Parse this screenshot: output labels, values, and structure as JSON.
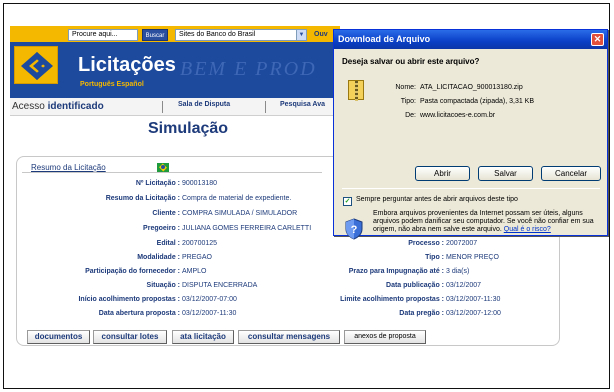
{
  "header": {
    "search_placeholder": "Procure aqui...",
    "search_button": "Buscar",
    "sites_select": "Sites do Banco do Brasil",
    "ouvidoria": "Ouv",
    "ghost_text": "BEM E PROD",
    "title": "Licitações",
    "language": "Português Español"
  },
  "nav": {
    "acesso_prefix": "Acesso",
    "acesso_bold": "identificado",
    "sala": "Sala de Disputa",
    "pesquisa": "Pesquisa Ava"
  },
  "page_title": "Simulação",
  "summary": {
    "heading": "Resumo da Licitação",
    "left": [
      {
        "label": "Nº Licitação :",
        "value": "900013180"
      },
      {
        "label": "Resumo da Licitação :",
        "value": "Compra de material de expediente."
      },
      {
        "label": "Cliente :",
        "value": "COMPRA SIMULADA  / SIMULADOR"
      },
      {
        "label": "Pregoeiro :",
        "value": "JULIANA GOMES FERREIRA CARLETTI"
      },
      {
        "label": "Edital :",
        "value": "200700125"
      },
      {
        "label": "Modalidade :",
        "value": "PREGAO"
      },
      {
        "label": "Participação do fornecedor :",
        "value": "AMPLO"
      },
      {
        "label": "Situação :",
        "value": "DISPUTA ENCERRADA"
      },
      {
        "label": "Início acolhimento propostas :",
        "value": "03/12/2007-07:00"
      },
      {
        "label": "Data abertura proposta :",
        "value": "03/12/2007-11:30"
      }
    ],
    "right": [
      {
        "label": "Processo :",
        "value": "20072007"
      },
      {
        "label": "Tipo :",
        "value": "MENOR PREÇO"
      },
      {
        "label": "Prazo para Impugnação até :",
        "value": "3 dia(s)"
      },
      {
        "label": "Data publicação :",
        "value": "03/12/2007"
      },
      {
        "label": "Limite acolhimento propostas :",
        "value": "03/12/2007-11:30"
      },
      {
        "label": "Data pregão :",
        "value": "03/12/2007-12:00"
      }
    ],
    "buttons": [
      "documentos",
      "consultar lotes",
      "ata licitação",
      "consultar mensagens",
      "anexos de proposta"
    ]
  },
  "dialog": {
    "title": "Download de Arquivo",
    "question": "Deseja salvar ou abrir este arquivo?",
    "name_label": "Nome:",
    "name_value": "ATA_LICITACAO_900013180.zip",
    "type_label": "Tipo:",
    "type_value": "Pasta compactada (zipada), 3,31 KB",
    "from_label": "De:",
    "from_value": "www.licitacoes-e.com.br",
    "open": "Abrir",
    "save": "Salvar",
    "cancel": "Cancelar",
    "always_ask": "Sempre perguntar antes de abrir arquivos deste tipo",
    "always_ask_checked": true,
    "warning": "Embora arquivos provenientes da Internet possam ser úteis, alguns arquivos podem danificar seu computador. Se você não confiar em sua origem, não abra nem salve este arquivo.",
    "risk_link": "Qual é o risco?"
  },
  "colors": {
    "bb_blue": "#1d4a9d",
    "bb_yellow": "#f4b800",
    "xp_title": "#0a3fc6",
    "dialog_bg": "#ece9d8"
  }
}
